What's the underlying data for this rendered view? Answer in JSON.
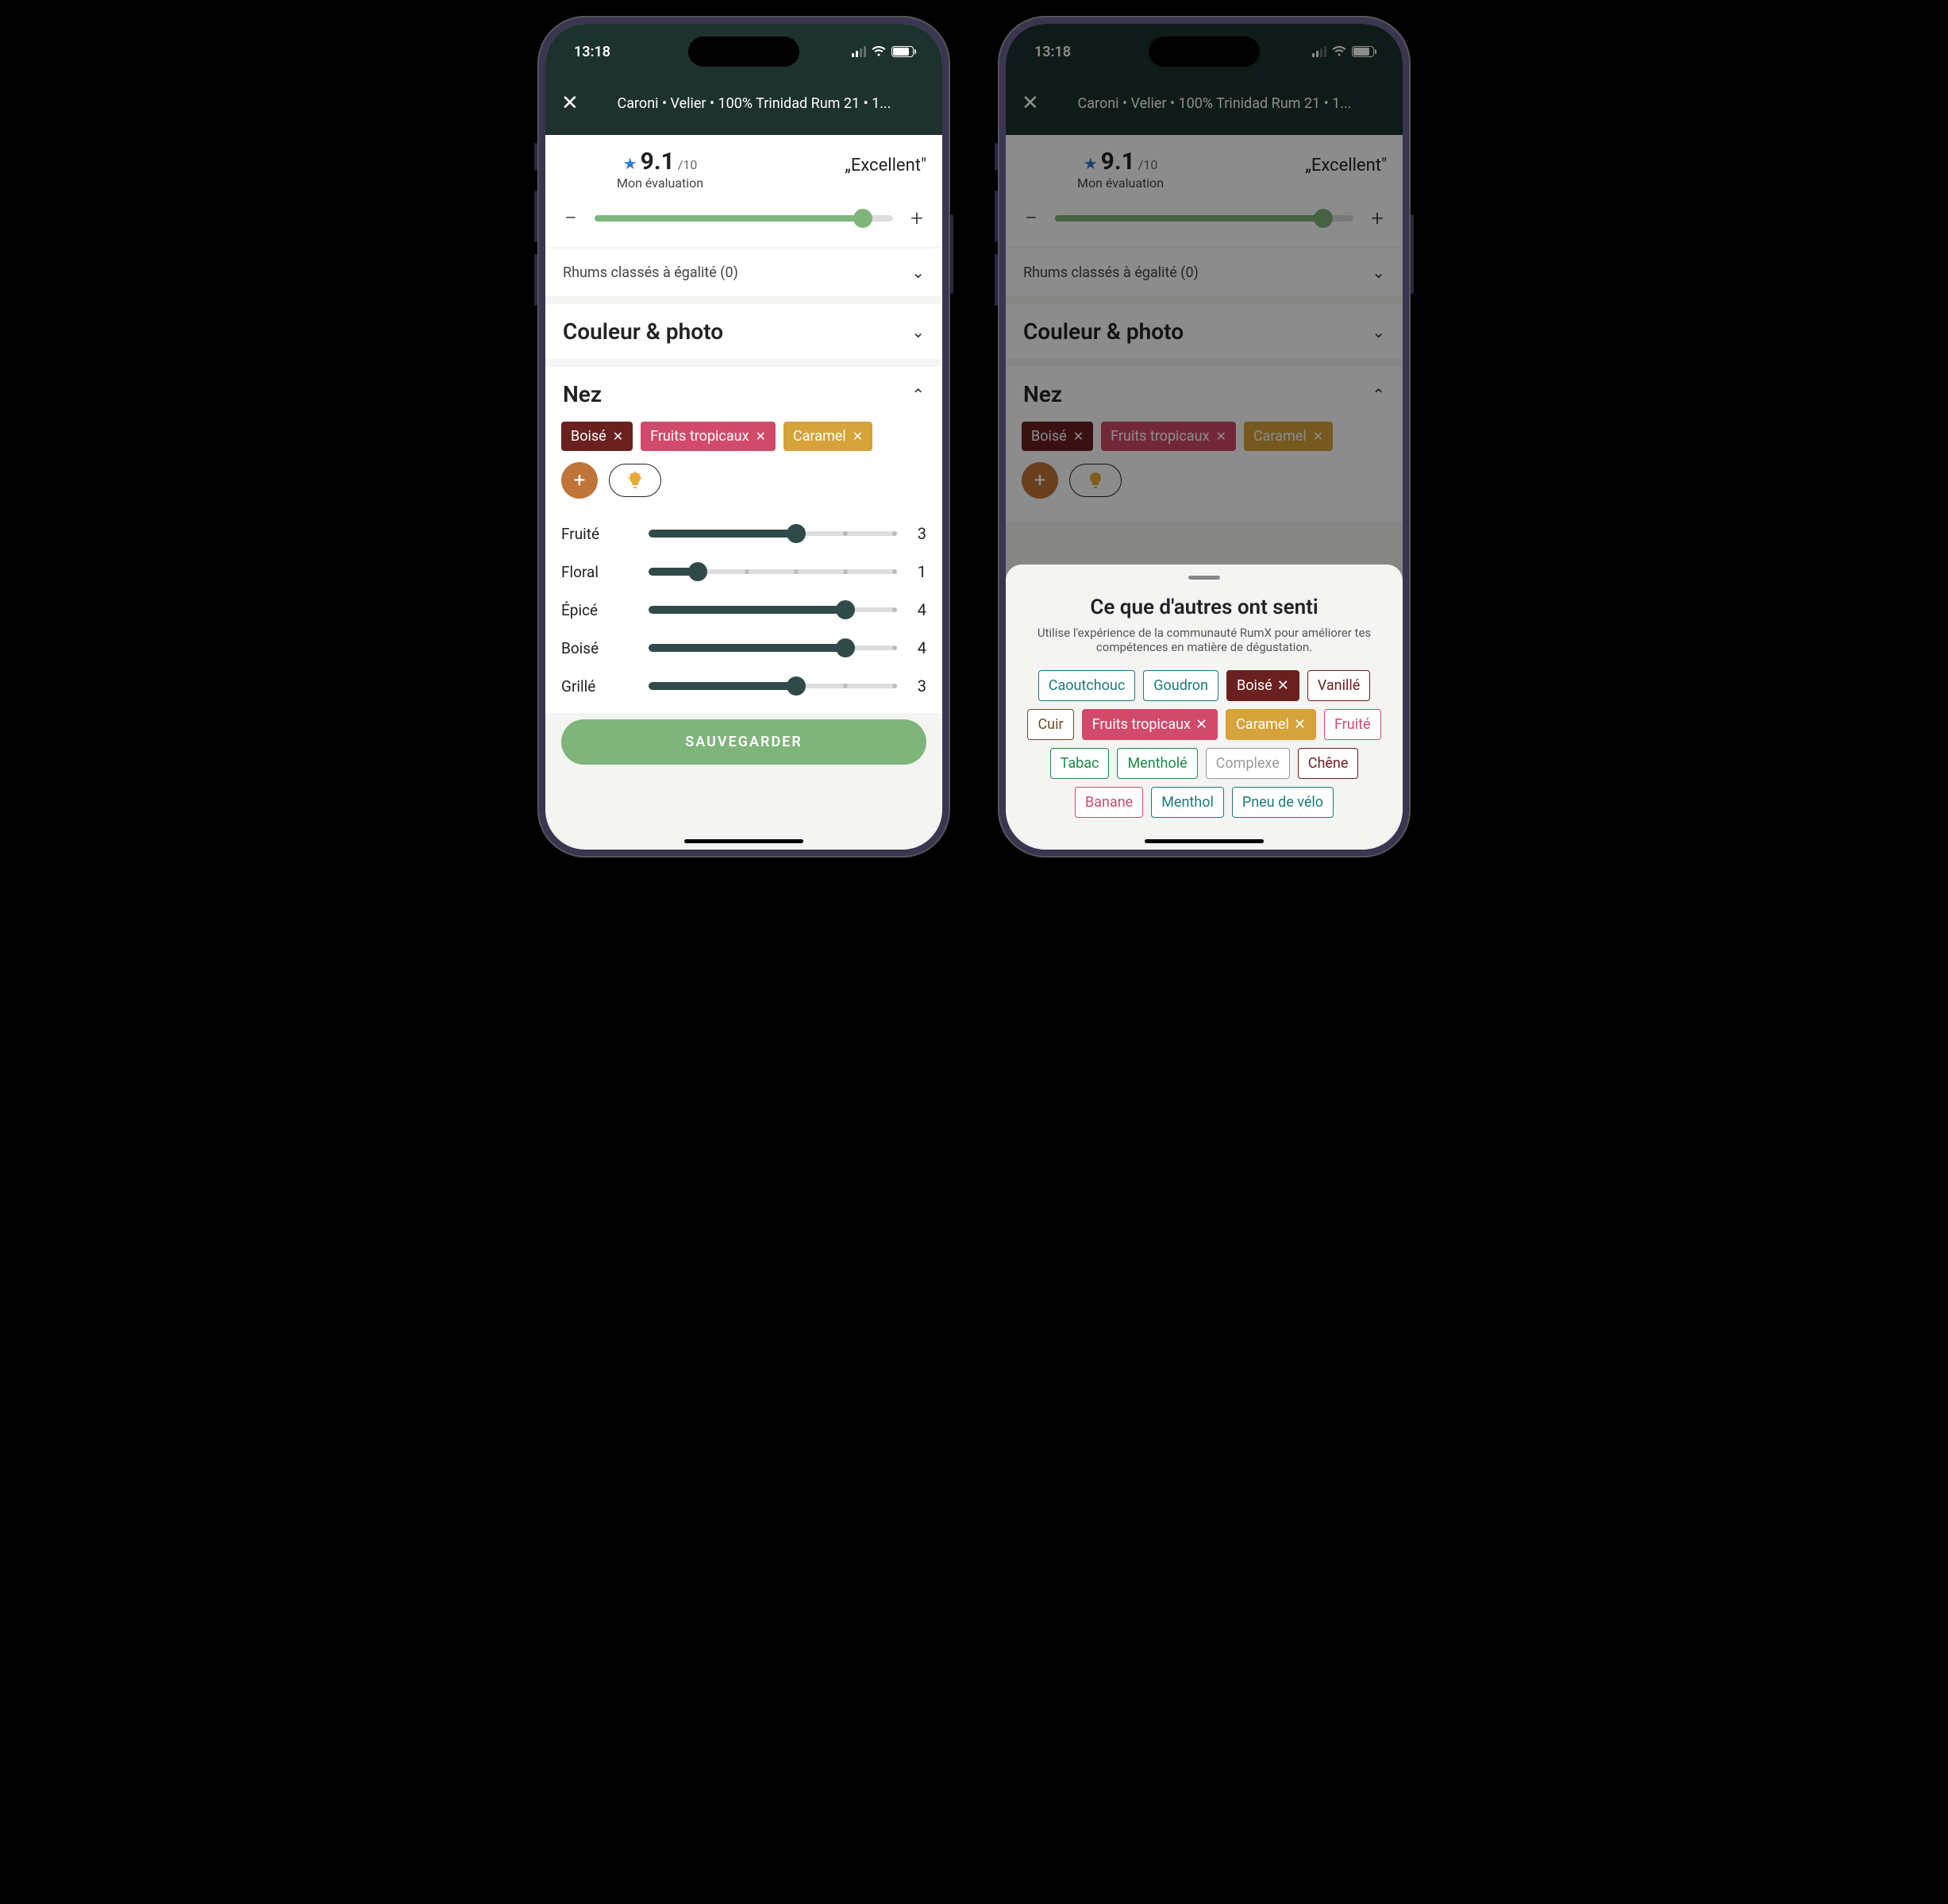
{
  "status": {
    "time": "13:18"
  },
  "appbar": {
    "title": "Caroni • Velier • 100% Trinidad Rum 21 • 1..."
  },
  "rating": {
    "score": "9.1",
    "outof": "/10",
    "sub": "Mon évaluation",
    "word": "„Excellent\"",
    "sliderPercent": 90
  },
  "tiedRow": {
    "label": "Rhums classés à égalité (0)"
  },
  "colorSection": {
    "label": "Couleur & photo"
  },
  "nez": {
    "label": "Nez",
    "chips": [
      {
        "label": "Boisé",
        "color": "#6b2020"
      },
      {
        "label": "Fruits tropicaux",
        "color": "#d14a6a"
      },
      {
        "label": "Caramel",
        "color": "#d6a23a"
      }
    ],
    "attrs": [
      {
        "label": "Fruité",
        "value": 3,
        "max": 5
      },
      {
        "label": "Floral",
        "value": 1,
        "max": 5
      },
      {
        "label": "Épicé",
        "value": 4,
        "max": 5
      },
      {
        "label": "Boisé",
        "value": 4,
        "max": 5
      },
      {
        "label": "Grillé",
        "value": 3,
        "max": 5
      }
    ]
  },
  "saveLabel": "SAUVEGARDER",
  "sheet": {
    "title": "Ce que d'autres ont senti",
    "sub": "Utilise l'expérience de la communauté RumX pour améliorer tes compétences en matière de dégustation.",
    "chips": [
      {
        "label": "Caoutchouc",
        "color": "#1a7a7a",
        "filled": false
      },
      {
        "label": "Goudron",
        "color": "#1a7a7a",
        "filled": false
      },
      {
        "label": "Boisé",
        "color": "#6b2020",
        "filled": true,
        "x": true
      },
      {
        "label": "Vanillé",
        "color": "#6b2020",
        "filled": false
      },
      {
        "label": "Cuir",
        "color": "#6b4a2a",
        "filled": false
      },
      {
        "label": "Fruits tropicaux",
        "color": "#d14a6a",
        "filled": true,
        "x": true
      },
      {
        "label": "Caramel",
        "color": "#d6a23a",
        "filled": true,
        "x": true
      },
      {
        "label": "Fruité",
        "color": "#d14a6a",
        "filled": false
      },
      {
        "label": "Tabac",
        "color": "#1a8a4a",
        "filled": false
      },
      {
        "label": "Mentholé",
        "color": "#1a8a4a",
        "filled": false
      },
      {
        "label": "Complexe",
        "color": "#999",
        "filled": false
      },
      {
        "label": "Chêne",
        "color": "#6b2020",
        "filled": false
      },
      {
        "label": "Banane",
        "color": "#d14a6a",
        "filled": false
      },
      {
        "label": "Menthol",
        "color": "#1a7a7a",
        "filled": false
      },
      {
        "label": "Pneu de vélo",
        "color": "#1a7a7a",
        "filled": false
      }
    ]
  }
}
